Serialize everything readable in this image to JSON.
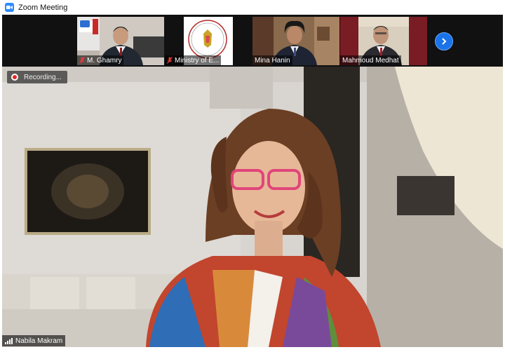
{
  "window": {
    "title": "Zoom Meeting"
  },
  "participants": [
    {
      "name": "M. Ghamry",
      "muted": true
    },
    {
      "name": "Ministry of E...",
      "muted": true
    },
    {
      "name": "Mina Hanin",
      "muted": false
    },
    {
      "name": "Mahmoud Medhat",
      "muted": false
    }
  ],
  "main": {
    "recording_label": "Recording...",
    "speaker_name": "Nabila Makram"
  },
  "colors": {
    "zoom_blue": "#2D8CFF",
    "recording_red": "#E02828",
    "next_button": "#1A73E8"
  },
  "icons": [
    "video-camera-icon",
    "mic-off-icon",
    "chevron-right-icon",
    "recording-icon",
    "signal-icon"
  ]
}
